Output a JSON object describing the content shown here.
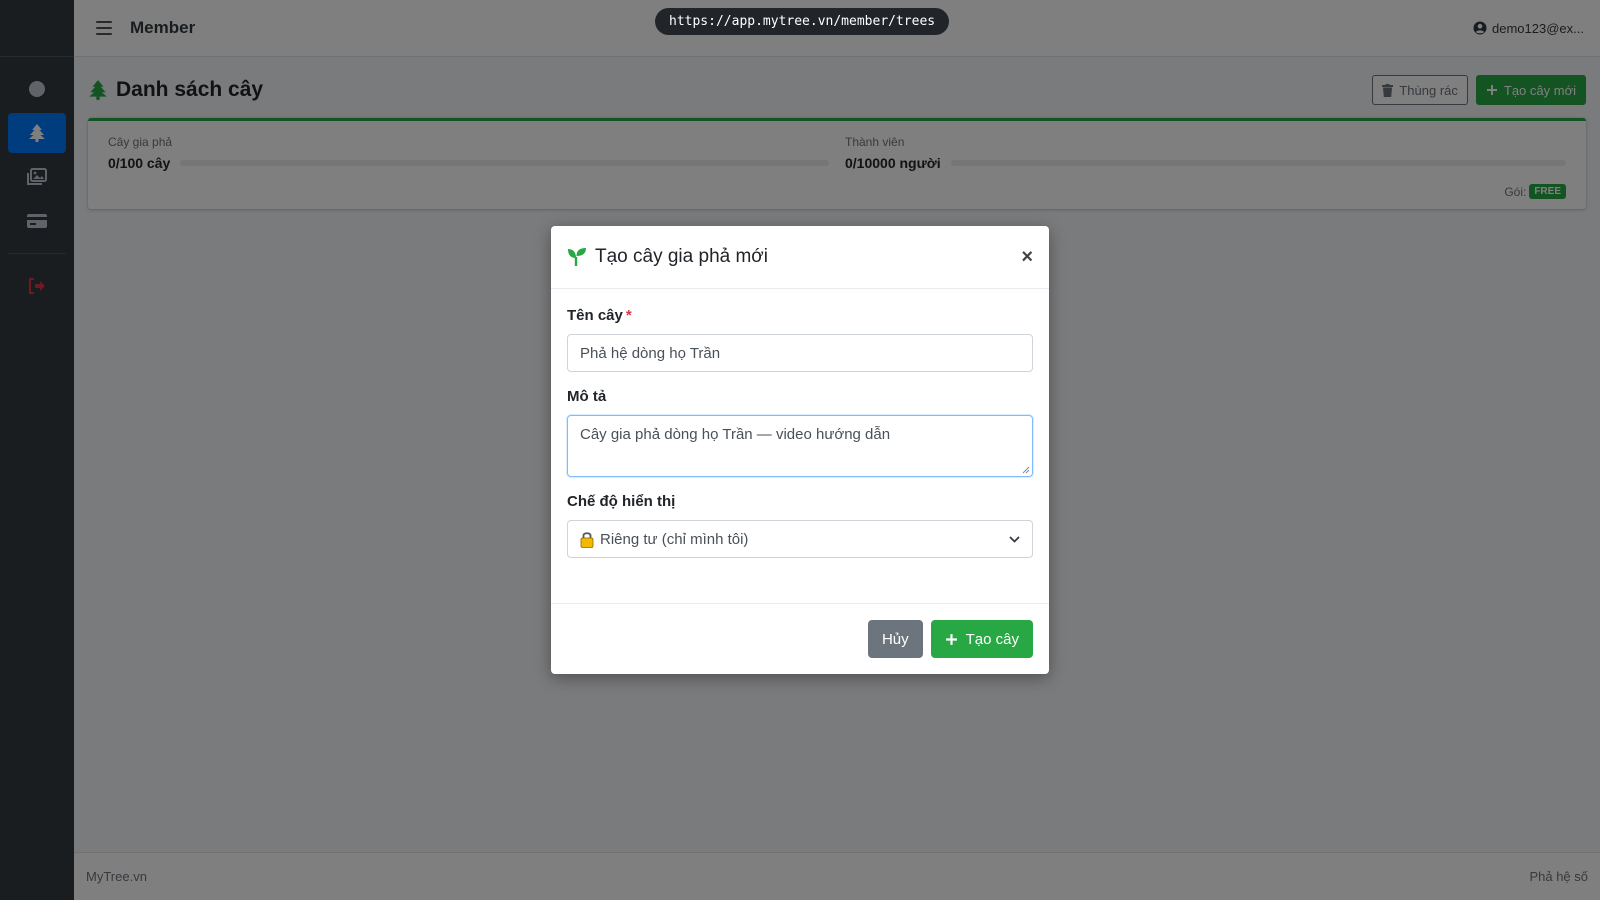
{
  "browser": {
    "url": "https://app.mytree.vn/member/trees"
  },
  "topbar": {
    "title": "Member",
    "user_email": "demo123@ex..."
  },
  "sidebar": {
    "items": [
      {
        "icon": "circle-icon"
      },
      {
        "icon": "tree-icon",
        "active": true
      },
      {
        "icon": "images-icon"
      },
      {
        "icon": "credit-card-icon"
      },
      {
        "icon": "logout-icon"
      }
    ]
  },
  "page": {
    "title": "Danh sách cây",
    "trash_label": "Thùng rác",
    "create_label": "Tạo cây mới"
  },
  "usage": {
    "trees_label": "Cây gia phả",
    "trees_value": "0/100 cây",
    "trees_fraction": 0,
    "members_label": "Thành viên",
    "members_value": "0/10000 người",
    "members_fraction": 0,
    "plan_label": "Gói:",
    "plan_badge": "FREE"
  },
  "footer": {
    "left": "MyTree.vn",
    "right": "Phả hệ số"
  },
  "modal": {
    "title": "Tạo cây gia phả mới",
    "name_label": "Tên cây",
    "required_mark": "*",
    "name_value": "Phả hệ dòng họ Trần",
    "desc_label": "Mô tả",
    "desc_value": "Cây gia phả dòng họ Trần — video hướng dẫn",
    "visibility_label": "Chế độ hiển thị",
    "visibility_value": "Riêng tư (chỉ mình tôi)",
    "cancel_label": "Hủy",
    "submit_label": "Tạo cây"
  },
  "colors": {
    "primary": "#007bff",
    "success": "#28a745",
    "sidebar": "#343a40",
    "danger": "#dc3545"
  }
}
